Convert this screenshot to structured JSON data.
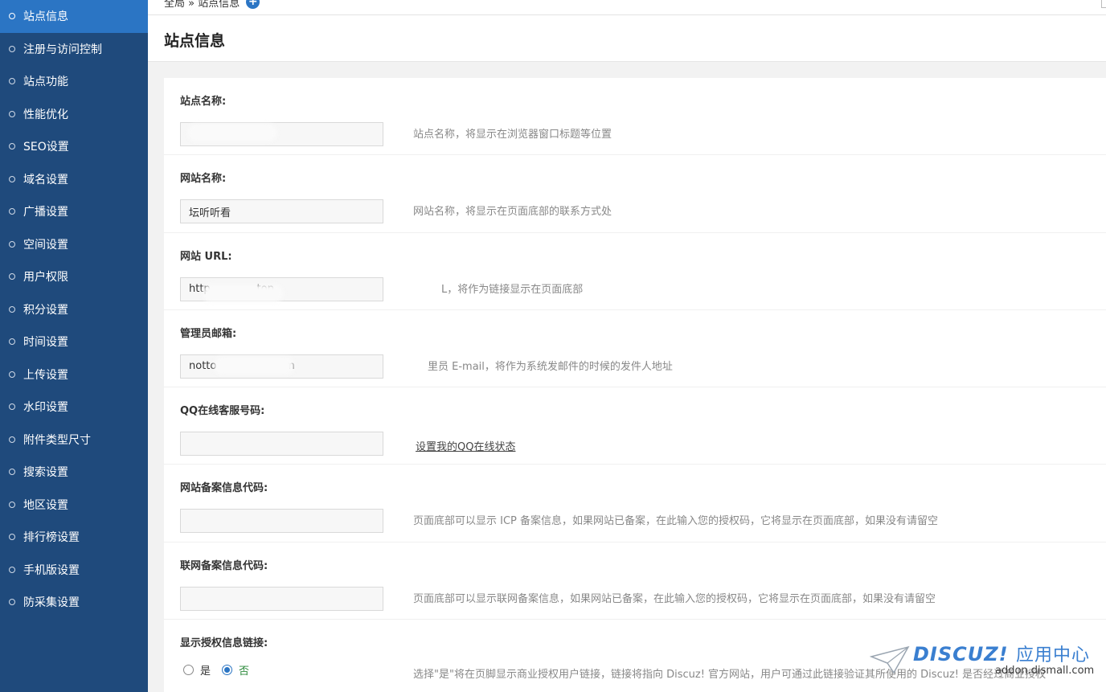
{
  "sidebar": {
    "items": [
      {
        "label": "站点信息",
        "active": true
      },
      {
        "label": "注册与访问控制"
      },
      {
        "label": "站点功能"
      },
      {
        "label": "性能优化"
      },
      {
        "label": "SEO设置"
      },
      {
        "label": "域名设置"
      },
      {
        "label": "广播设置"
      },
      {
        "label": "空间设置"
      },
      {
        "label": "用户权限"
      },
      {
        "label": "积分设置"
      },
      {
        "label": "时间设置"
      },
      {
        "label": "上传设置"
      },
      {
        "label": "水印设置"
      },
      {
        "label": "附件类型尺寸"
      },
      {
        "label": "搜索设置"
      },
      {
        "label": "地区设置"
      },
      {
        "label": "排行榜设置"
      },
      {
        "label": "手机版设置"
      },
      {
        "label": "防采集设置"
      }
    ]
  },
  "breadcrumb": {
    "text": "全局 » 站点信息",
    "add": "+"
  },
  "header": {
    "title": "站点信息"
  },
  "form": {
    "site_name": {
      "label": "站点名称:",
      "value": "",
      "hint": "站点名称，将显示在浏览器窗口标题等位置"
    },
    "web_name": {
      "label": "网站名称:",
      "value": "坛听听看",
      "hint": "网站名称，将显示在页面底部的联系方式处"
    },
    "web_url": {
      "label": "网站 URL:",
      "value": "http              top",
      "hint": "L，将作为链接显示在页面底部"
    },
    "admin_email": {
      "label": "管理员邮箱:",
      "value": "notto              x.com",
      "hint": "里员 E-mail，将作为系统发邮件的时候的发件人地址"
    },
    "qq": {
      "label": "QQ在线客服号码:",
      "value": "",
      "link": "设置我的QQ在线状态"
    },
    "icp": {
      "label": "网站备案信息代码:",
      "value": "",
      "hint": "页面底部可以显示 ICP 备案信息，如果网站已备案，在此输入您的授权码，它将显示在页面底部，如果没有请留空"
    },
    "mps": {
      "label": "联网备案信息代码:",
      "value": "",
      "hint": "页面底部可以显示联网备案信息，如果网站已备案，在此输入您的授权码，它将显示在页面底部，如果没有请留空"
    },
    "license": {
      "label": "显示授权信息链接:",
      "yes": "是",
      "no": "否",
      "hint": "选择\"是\"将在页脚显示商业授权用户链接，链接将指向 Discuz! 官方网站，用户可通过此链接验证其所使用的 Discuz! 是否经过商业授权"
    }
  },
  "watermark": {
    "brand": "DISCUZ!",
    "cn": "应用中心",
    "domain": "addon.dismall.com"
  },
  "colors": {
    "sidebar_bg": "#1f4a7c",
    "sidebar_active": "#2b75c4",
    "accent": "#2b75c4"
  }
}
